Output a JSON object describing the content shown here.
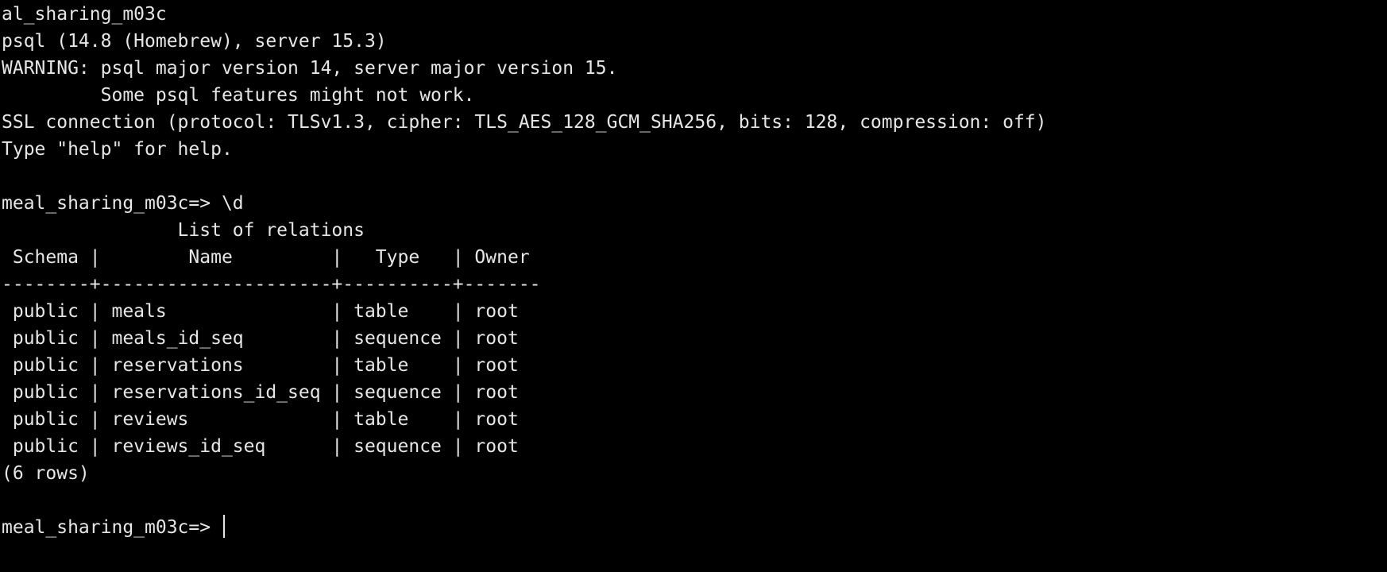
{
  "terminal": {
    "lines": [
      "al_sharing_m03c",
      "psql (14.8 (Homebrew), server 15.3)",
      "WARNING: psql major version 14, server major version 15.",
      "         Some psql features might not work.",
      "SSL connection (protocol: TLSv1.3, cipher: TLS_AES_128_GCM_SHA256, bits: 128, compression: off)",
      "Type \"help\" for help.",
      "",
      "meal_sharing_m03c=> \\d",
      "                List of relations",
      " Schema |        Name         |   Type   | Owner",
      "--------+---------------------+----------+-------",
      " public | meals               | table    | root",
      " public | meals_id_seq        | sequence | root",
      " public | reservations        | table    | root",
      " public | reservations_id_seq | sequence | root",
      " public | reviews             | table    | root",
      " public | reviews_id_seq      | sequence | root",
      "(6 rows)",
      ""
    ],
    "prompt": "meal_sharing_m03c=> ",
    "background_color": "#000000",
    "text_color": "#e6e6e6"
  }
}
